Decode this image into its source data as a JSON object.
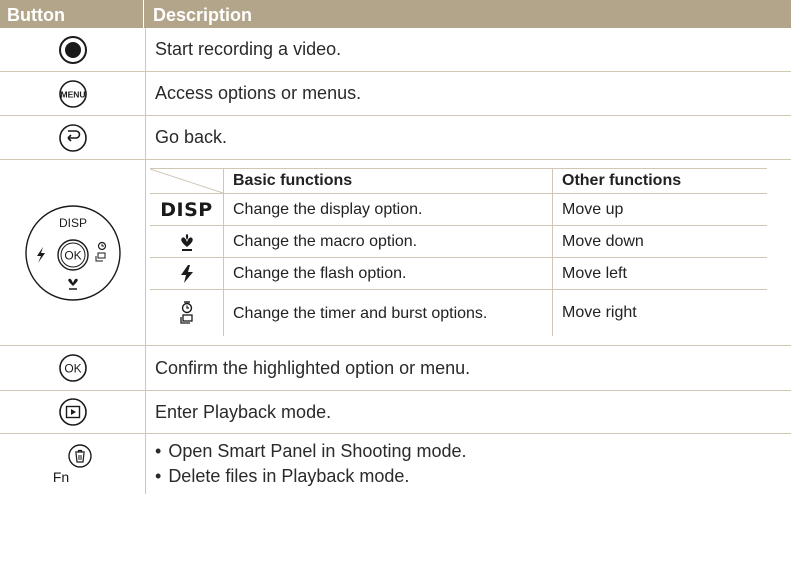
{
  "header": {
    "col_button": "Button",
    "col_description": "Description"
  },
  "rows": {
    "record": {
      "icon": "record-button-icon",
      "description": "Start recording a video."
    },
    "menu": {
      "icon": "menu-button-icon",
      "icon_text": "MENU",
      "description": "Access options or menus."
    },
    "back": {
      "icon": "back-button-icon",
      "description": "Go back."
    },
    "navigation": {
      "icon": "navigation-dial-icon",
      "dial_top": "DISP",
      "dial_center": "OK",
      "subtable": {
        "col_basic": "Basic functions",
        "col_other": "Other functions",
        "rows": [
          {
            "icon": "disp-label",
            "icon_text": "DISP",
            "basic": "Change the display option.",
            "other": "Move up"
          },
          {
            "icon": "macro-icon",
            "basic": "Change the macro option.",
            "other": "Move down"
          },
          {
            "icon": "flash-icon",
            "basic": "Change the flash option.",
            "other": "Move left"
          },
          {
            "icon": "timer-burst-icon",
            "basic": "Change the timer and burst options.",
            "other": "Move right"
          }
        ]
      }
    },
    "ok": {
      "icon": "ok-button-icon",
      "icon_text": "OK",
      "description": "Confirm the highlighted option or menu."
    },
    "playback": {
      "icon": "playback-button-icon",
      "description": "Enter Playback mode."
    },
    "fn": {
      "icon": "fn-delete-button-icon",
      "icon_text": "Fn",
      "bullets": [
        "Open Smart Panel in Shooting mode.",
        "Delete files in Playback mode."
      ]
    }
  },
  "colors": {
    "header_bg": "#b3a58a",
    "rule": "#cfc6b4"
  }
}
